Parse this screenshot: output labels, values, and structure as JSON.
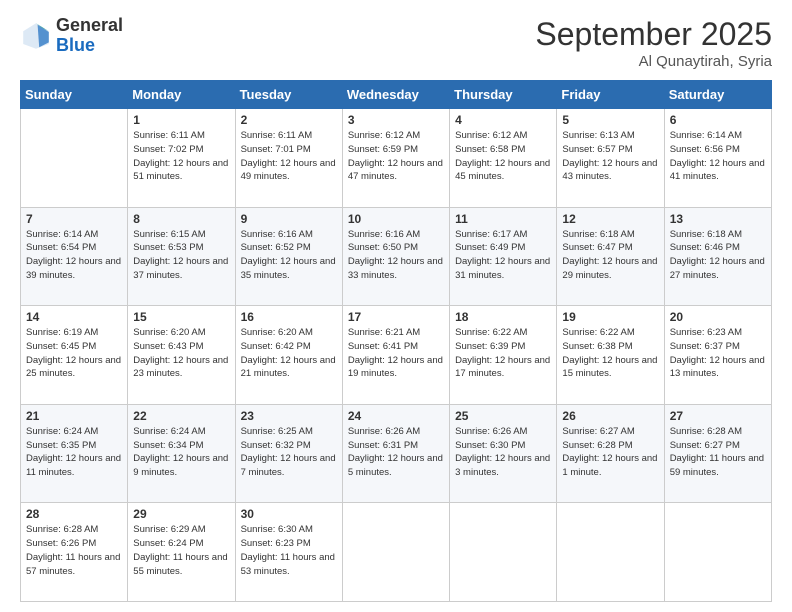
{
  "header": {
    "logo_general": "General",
    "logo_blue": "Blue",
    "month_title": "September 2025",
    "location": "Al Qunaytirah, Syria"
  },
  "days_of_week": [
    "Sunday",
    "Monday",
    "Tuesday",
    "Wednesday",
    "Thursday",
    "Friday",
    "Saturday"
  ],
  "weeks": [
    [
      {
        "day": "",
        "sunrise": "",
        "sunset": "",
        "daylight": ""
      },
      {
        "day": "1",
        "sunrise": "Sunrise: 6:11 AM",
        "sunset": "Sunset: 7:02 PM",
        "daylight": "Daylight: 12 hours and 51 minutes."
      },
      {
        "day": "2",
        "sunrise": "Sunrise: 6:11 AM",
        "sunset": "Sunset: 7:01 PM",
        "daylight": "Daylight: 12 hours and 49 minutes."
      },
      {
        "day": "3",
        "sunrise": "Sunrise: 6:12 AM",
        "sunset": "Sunset: 6:59 PM",
        "daylight": "Daylight: 12 hours and 47 minutes."
      },
      {
        "day": "4",
        "sunrise": "Sunrise: 6:12 AM",
        "sunset": "Sunset: 6:58 PM",
        "daylight": "Daylight: 12 hours and 45 minutes."
      },
      {
        "day": "5",
        "sunrise": "Sunrise: 6:13 AM",
        "sunset": "Sunset: 6:57 PM",
        "daylight": "Daylight: 12 hours and 43 minutes."
      },
      {
        "day": "6",
        "sunrise": "Sunrise: 6:14 AM",
        "sunset": "Sunset: 6:56 PM",
        "daylight": "Daylight: 12 hours and 41 minutes."
      }
    ],
    [
      {
        "day": "7",
        "sunrise": "Sunrise: 6:14 AM",
        "sunset": "Sunset: 6:54 PM",
        "daylight": "Daylight: 12 hours and 39 minutes."
      },
      {
        "day": "8",
        "sunrise": "Sunrise: 6:15 AM",
        "sunset": "Sunset: 6:53 PM",
        "daylight": "Daylight: 12 hours and 37 minutes."
      },
      {
        "day": "9",
        "sunrise": "Sunrise: 6:16 AM",
        "sunset": "Sunset: 6:52 PM",
        "daylight": "Daylight: 12 hours and 35 minutes."
      },
      {
        "day": "10",
        "sunrise": "Sunrise: 6:16 AM",
        "sunset": "Sunset: 6:50 PM",
        "daylight": "Daylight: 12 hours and 33 minutes."
      },
      {
        "day": "11",
        "sunrise": "Sunrise: 6:17 AM",
        "sunset": "Sunset: 6:49 PM",
        "daylight": "Daylight: 12 hours and 31 minutes."
      },
      {
        "day": "12",
        "sunrise": "Sunrise: 6:18 AM",
        "sunset": "Sunset: 6:47 PM",
        "daylight": "Daylight: 12 hours and 29 minutes."
      },
      {
        "day": "13",
        "sunrise": "Sunrise: 6:18 AM",
        "sunset": "Sunset: 6:46 PM",
        "daylight": "Daylight: 12 hours and 27 minutes."
      }
    ],
    [
      {
        "day": "14",
        "sunrise": "Sunrise: 6:19 AM",
        "sunset": "Sunset: 6:45 PM",
        "daylight": "Daylight: 12 hours and 25 minutes."
      },
      {
        "day": "15",
        "sunrise": "Sunrise: 6:20 AM",
        "sunset": "Sunset: 6:43 PM",
        "daylight": "Daylight: 12 hours and 23 minutes."
      },
      {
        "day": "16",
        "sunrise": "Sunrise: 6:20 AM",
        "sunset": "Sunset: 6:42 PM",
        "daylight": "Daylight: 12 hours and 21 minutes."
      },
      {
        "day": "17",
        "sunrise": "Sunrise: 6:21 AM",
        "sunset": "Sunset: 6:41 PM",
        "daylight": "Daylight: 12 hours and 19 minutes."
      },
      {
        "day": "18",
        "sunrise": "Sunrise: 6:22 AM",
        "sunset": "Sunset: 6:39 PM",
        "daylight": "Daylight: 12 hours and 17 minutes."
      },
      {
        "day": "19",
        "sunrise": "Sunrise: 6:22 AM",
        "sunset": "Sunset: 6:38 PM",
        "daylight": "Daylight: 12 hours and 15 minutes."
      },
      {
        "day": "20",
        "sunrise": "Sunrise: 6:23 AM",
        "sunset": "Sunset: 6:37 PM",
        "daylight": "Daylight: 12 hours and 13 minutes."
      }
    ],
    [
      {
        "day": "21",
        "sunrise": "Sunrise: 6:24 AM",
        "sunset": "Sunset: 6:35 PM",
        "daylight": "Daylight: 12 hours and 11 minutes."
      },
      {
        "day": "22",
        "sunrise": "Sunrise: 6:24 AM",
        "sunset": "Sunset: 6:34 PM",
        "daylight": "Daylight: 12 hours and 9 minutes."
      },
      {
        "day": "23",
        "sunrise": "Sunrise: 6:25 AM",
        "sunset": "Sunset: 6:32 PM",
        "daylight": "Daylight: 12 hours and 7 minutes."
      },
      {
        "day": "24",
        "sunrise": "Sunrise: 6:26 AM",
        "sunset": "Sunset: 6:31 PM",
        "daylight": "Daylight: 12 hours and 5 minutes."
      },
      {
        "day": "25",
        "sunrise": "Sunrise: 6:26 AM",
        "sunset": "Sunset: 6:30 PM",
        "daylight": "Daylight: 12 hours and 3 minutes."
      },
      {
        "day": "26",
        "sunrise": "Sunrise: 6:27 AM",
        "sunset": "Sunset: 6:28 PM",
        "daylight": "Daylight: 12 hours and 1 minute."
      },
      {
        "day": "27",
        "sunrise": "Sunrise: 6:28 AM",
        "sunset": "Sunset: 6:27 PM",
        "daylight": "Daylight: 11 hours and 59 minutes."
      }
    ],
    [
      {
        "day": "28",
        "sunrise": "Sunrise: 6:28 AM",
        "sunset": "Sunset: 6:26 PM",
        "daylight": "Daylight: 11 hours and 57 minutes."
      },
      {
        "day": "29",
        "sunrise": "Sunrise: 6:29 AM",
        "sunset": "Sunset: 6:24 PM",
        "daylight": "Daylight: 11 hours and 55 minutes."
      },
      {
        "day": "30",
        "sunrise": "Sunrise: 6:30 AM",
        "sunset": "Sunset: 6:23 PM",
        "daylight": "Daylight: 11 hours and 53 minutes."
      },
      {
        "day": "",
        "sunrise": "",
        "sunset": "",
        "daylight": ""
      },
      {
        "day": "",
        "sunrise": "",
        "sunset": "",
        "daylight": ""
      },
      {
        "day": "",
        "sunrise": "",
        "sunset": "",
        "daylight": ""
      },
      {
        "day": "",
        "sunrise": "",
        "sunset": "",
        "daylight": ""
      }
    ]
  ]
}
